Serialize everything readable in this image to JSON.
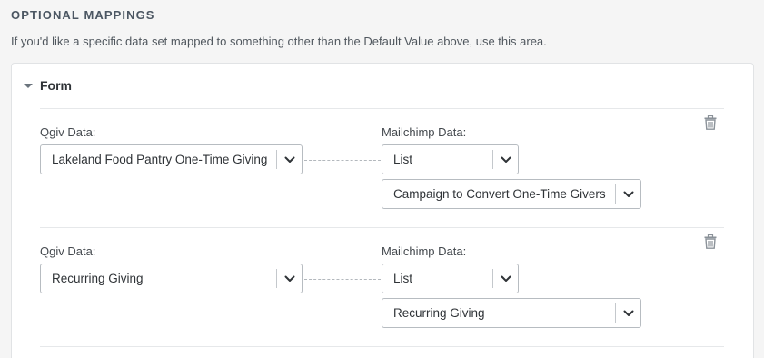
{
  "section": {
    "title": "OPTIONAL MAPPINGS",
    "description": "If you'd like a specific data set mapped to something other than the Default Value above, use this area."
  },
  "form": {
    "label": "Form"
  },
  "mappings": [
    {
      "qgiv_label": "Qgiv Data:",
      "qgiv_value": "Lakeland Food Pantry One-Time Giving",
      "mailchimp_label": "Mailchimp Data:",
      "mailchimp_type": "List",
      "mailchimp_value": "Campaign to Convert One-Time Givers"
    },
    {
      "qgiv_label": "Qgiv Data:",
      "qgiv_value": "Recurring Giving",
      "mailchimp_label": "Mailchimp Data:",
      "mailchimp_type": "List",
      "mailchimp_value": "Recurring Giving"
    }
  ],
  "icons": {
    "dropdown": "chevron-down-icon",
    "delete": "trash-icon",
    "collapse": "caret-down-icon"
  }
}
